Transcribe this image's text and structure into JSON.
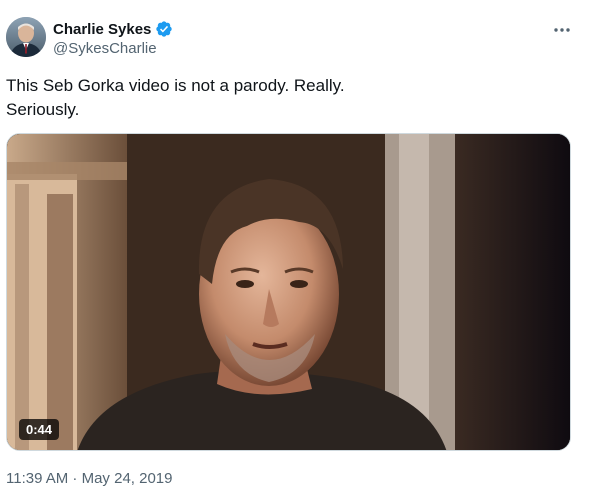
{
  "author": {
    "display_name": "Charlie Sykes",
    "handle": "@SykesCharlie",
    "verified": true,
    "verified_color": "#1d9bf0"
  },
  "more_icon": "more-horizontal-icon",
  "tweet": {
    "text_lines": [
      "This Seb Gorka video is not a parody. Really.",
      "Seriously."
    ]
  },
  "media": {
    "type": "video",
    "duration": "0:44"
  },
  "timestamp": "11:39 AM · May 24, 2019"
}
